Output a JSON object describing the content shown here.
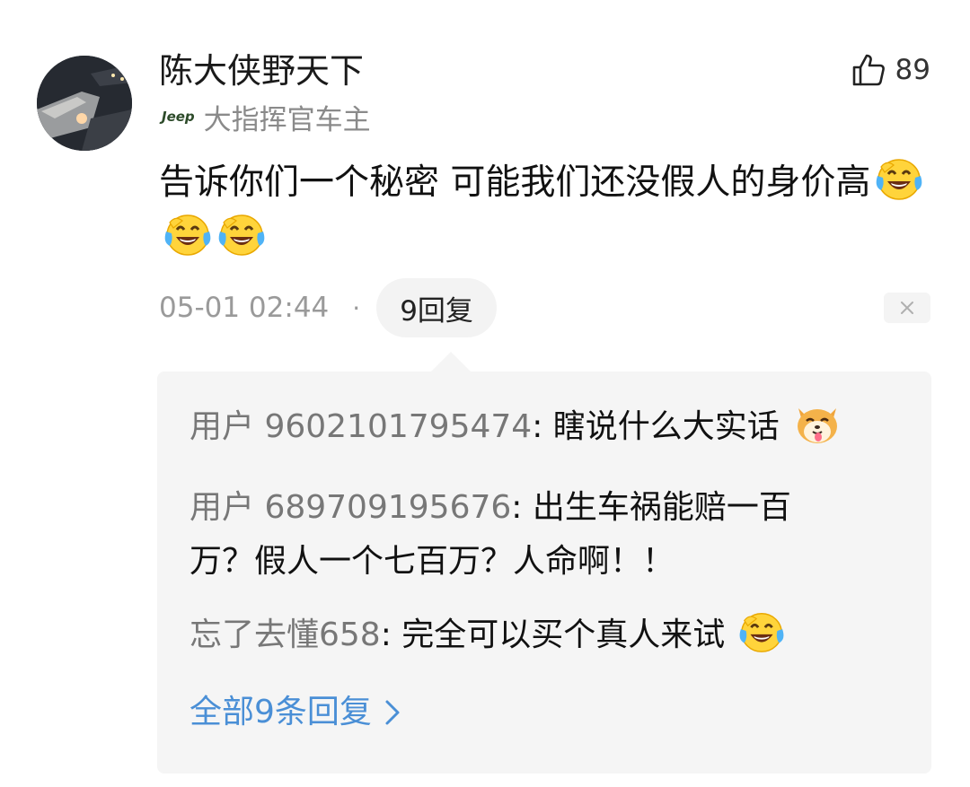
{
  "comment": {
    "username": "陈大侠野天下",
    "brand_logo": "Jeep",
    "badge": "大指挥官车主",
    "like_count": "89",
    "text": "告诉你们一个秘密 可能我们还没假人的身价高",
    "emojis": [
      "laugh-cry-emoji",
      "laugh-cry-emoji",
      "laugh-cry-emoji"
    ],
    "time": "05-01 02:44",
    "separator": "·",
    "reply_button": "9回复",
    "close_label": "×"
  },
  "replies": [
    {
      "author": "用户 9602101795474",
      "text": ": 瞎说什么大实话",
      "emoji": "shiba-dog-emoji"
    },
    {
      "author": "用户 689709195676",
      "text": ": 出生车祸能赔一百万？假人一个七百万？人命啊！！"
    },
    {
      "author": "忘了去懂658",
      "text": ": 完全可以买个真人来试",
      "emoji": "laugh-cry-emoji"
    }
  ],
  "view_all": "全部9条回复",
  "colors": {
    "link": "#4a8fd6",
    "muted": "#9a9a9a",
    "reply_bg": "#f5f5f5"
  }
}
